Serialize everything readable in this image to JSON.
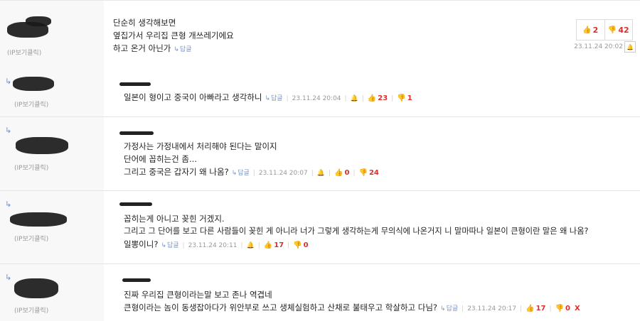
{
  "comments": [
    {
      "ip": "(IP보기클릭)",
      "lines": [
        "단순히 생각해보면",
        "옆집가서 우리집 큰형 개쓰레기에요",
        "하고 온거 아닌가"
      ],
      "reply": "답글",
      "date": "23.11.24 20:02",
      "up": "2",
      "down": "42"
    },
    {
      "ip": "(IP보기클릭)",
      "lines": [
        "일본이 형이고 중국이 아빠라고 생각하니"
      ],
      "reply": "답글",
      "date": "23.11.24 20:04",
      "up": "23",
      "down": "1"
    },
    {
      "ip": "(IP보기클릭)",
      "lines": [
        "가정사는 가정내에서 처리해야 된다는 말이지",
        "단어에 꼽히는건 좀...",
        "그리고 중국은 갑자기 왜 나옴?"
      ],
      "reply": "답글",
      "date": "23.11.24 20:07",
      "up": "0",
      "down": "24"
    },
    {
      "ip": "(IP보기클릭)",
      "lines": [
        "꼽히는게 아니고 꽂힌 거겠지.",
        "그리고 그 단어를 보고 다른 사람들이 꽂힌 게 아니라 너가 그렇게 생각하는게 무의식에 나온거지 니 말마따나 일본이 큰형이란 말은 왜 나옴?",
        "일뽕이니?"
      ],
      "reply": "답글",
      "date": "23.11.24 20:11",
      "up": "17",
      "down": "0"
    },
    {
      "ip": "(IP보기클릭)",
      "lines": [
        "진짜 우리집 큰형이라는말 보고 존나 역겹네",
        "큰형이라는 놈이 동생잡아다가 위안부로 쓰고 생체실험하고 산채로 불태우고 학살하고 다님?"
      ],
      "reply": "답글",
      "date": "23.11.24 20:17",
      "up": "17",
      "down": "0",
      "delete": "X"
    }
  ],
  "icons": {
    "reply_arrow": "reply-arrow-icon",
    "thumb_up": "thumb-up-icon",
    "thumb_down": "thumb-down-icon",
    "bell": "report-icon"
  },
  "colors": {
    "accent_red": "#d9302a",
    "accent_blue": "#4a7fd6",
    "meta_gray": "#999999"
  }
}
